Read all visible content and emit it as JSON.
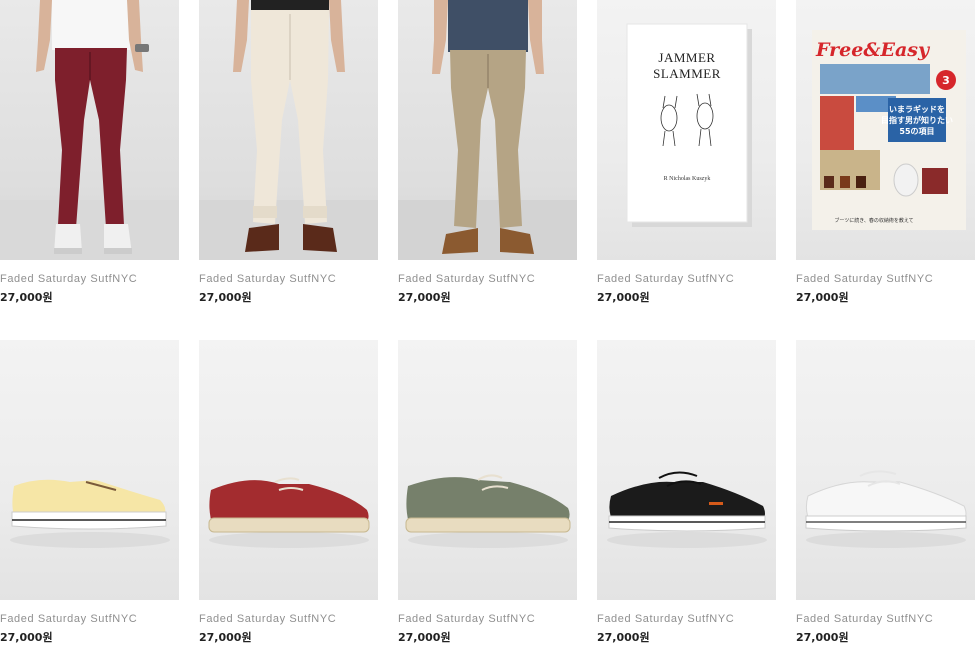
{
  "products": [
    {
      "brand": "Faded Saturday SutfNYC",
      "price": "27,000원",
      "image": "burgundy-skinny-jeans"
    },
    {
      "brand": "Faded Saturday SutfNYC",
      "price": "27,000원",
      "image": "cream-slim-jeans"
    },
    {
      "brand": "Faded Saturday SutfNYC",
      "price": "27,000원",
      "image": "khaki-chinos"
    },
    {
      "brand": "Faded Saturday SutfNYC",
      "price": "27,000원",
      "image": "jammer-slammer-book"
    },
    {
      "brand": "Faded Saturday SutfNYC",
      "price": "27,000원",
      "image": "free-and-easy-magazine"
    },
    {
      "brand": "Faded Saturday SutfNYC",
      "price": "27,000원",
      "image": "yellow-canvas-sneaker"
    },
    {
      "brand": "Faded Saturday SutfNYC",
      "price": "27,000원",
      "image": "red-espadrille-shoe"
    },
    {
      "brand": "Faded Saturday SutfNYC",
      "price": "27,000원",
      "image": "olive-espadrille-shoe"
    },
    {
      "brand": "Faded Saturday SutfNYC",
      "price": "27,000원",
      "image": "black-canvas-sneaker"
    },
    {
      "brand": "Faded Saturday SutfNYC",
      "price": "27,000원",
      "image": "white-canvas-sneaker"
    }
  ],
  "book": {
    "title_line1": "JAMMER",
    "title_line2": "SLAMMER",
    "author": "R Nicholas Kuszyk"
  },
  "magazine": {
    "title": "Free&Easy",
    "issue": "3",
    "headline1": "いまラギッドを",
    "headline2": "目指す男が知りたい",
    "headline3": "55の項目",
    "footer": "ブーツに続き、春の収納術を教えて"
  }
}
